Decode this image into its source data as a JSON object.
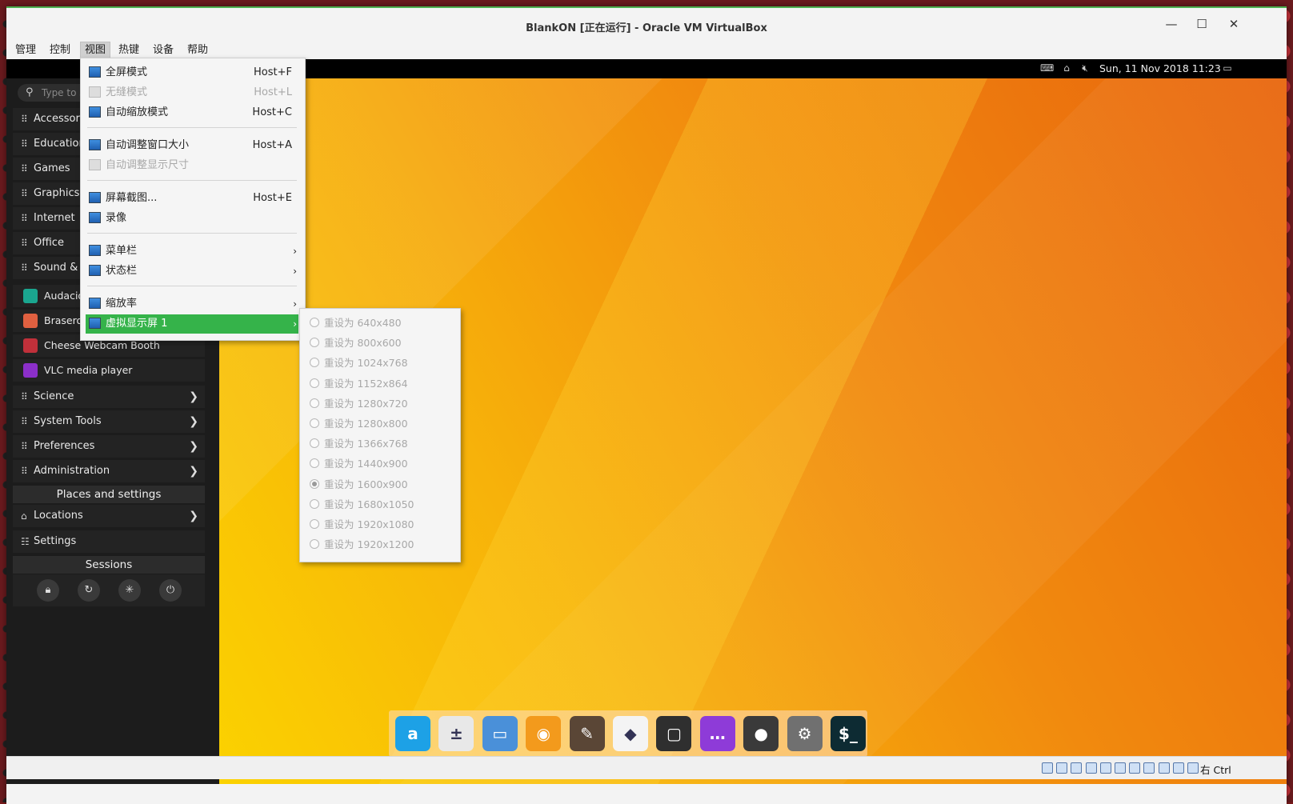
{
  "window": {
    "title": "BlankON [正在运行] - Oracle VM VirtualBox",
    "controls": {
      "minimize": "—",
      "maximize": "☐",
      "close": "✕"
    }
  },
  "menubar": {
    "items": [
      "管理",
      "控制",
      "视图",
      "热键",
      "设备",
      "帮助"
    ],
    "active": "视图"
  },
  "guest_topbar": {
    "clock": "Sun, 11 Nov 2018 11:23",
    "tray_icons": [
      "keyboard-icon",
      "home-icon",
      "volume-muted-icon",
      "window-icon"
    ]
  },
  "app_menu": {
    "search_placeholder": "Type to s",
    "categories_top": [
      "Accessories",
      "Education",
      "Games",
      "Graphics",
      "Internet",
      "Office",
      "Sound & V"
    ],
    "apps": [
      {
        "label": "Audacio",
        "icon": "audacious-icon",
        "color": "#1aa68f"
      },
      {
        "label": "Brasero",
        "icon": "brasero-icon",
        "color": "#e06040"
      },
      {
        "label": "Cheese Webcam Booth",
        "icon": "cheese-icon",
        "color": "#c0303a"
      },
      {
        "label": "VLC media player",
        "icon": "vlc-icon",
        "color": "#8b2fc9"
      }
    ],
    "categories_bottom": [
      "Science",
      "System Tools",
      "Preferences",
      "Administration"
    ],
    "places_header": "Places and settings",
    "locations": "Locations",
    "settings": "Settings",
    "sessions_header": "Sessions",
    "session_buttons": [
      "lock-icon",
      "refresh-icon",
      "suspend-icon",
      "power-icon"
    ]
  },
  "view_menu": {
    "items": [
      {
        "label": "全屏模式",
        "shortcut": "Host+F",
        "disabled": false
      },
      {
        "label": "无缝模式",
        "shortcut": "Host+L",
        "disabled": true
      },
      {
        "label": "自动缩放模式",
        "shortcut": "Host+C",
        "disabled": false
      },
      {
        "label": "自动调整窗口大小",
        "shortcut": "Host+A",
        "disabled": false
      },
      {
        "label": "自动调整显示尺寸",
        "shortcut": "",
        "disabled": true
      },
      {
        "label": "屏幕截图...",
        "shortcut": "Host+E",
        "disabled": false
      },
      {
        "label": "录像",
        "shortcut": "",
        "disabled": false
      },
      {
        "label": "菜单栏",
        "submenu": true
      },
      {
        "label": "状态栏",
        "submenu": true
      },
      {
        "label": "缩放率",
        "submenu": true
      },
      {
        "label": "虚拟显示屏 1",
        "submenu": true,
        "highlighted": true
      }
    ],
    "submenu_chevron": "›"
  },
  "display_submenu": {
    "items": [
      "重设为 640x480",
      "重设为 800x600",
      "重设为 1024x768",
      "重设为 1152x864",
      "重设为 1280x720",
      "重设为 1280x800",
      "重设为 1366x768",
      "重设为 1440x900",
      "重设为 1600x900",
      "重设为 1680x1050",
      "重设为 1920x1080",
      "重设为 1920x1200"
    ],
    "checked": "重设为 1600x900"
  },
  "dock": {
    "apps": [
      {
        "icon": "app-center-icon",
        "glyph": "a",
        "color": "#1da1e6"
      },
      {
        "icon": "calculator-icon",
        "glyph": "±",
        "color": "#e8e8e8"
      },
      {
        "icon": "files-icon",
        "glyph": "▭",
        "color": "#4a90d9"
      },
      {
        "icon": "firefox-icon",
        "glyph": "◉",
        "color": "#f39a1c"
      },
      {
        "icon": "gimp-icon",
        "glyph": "✎",
        "color": "#5a4636"
      },
      {
        "icon": "inkscape-icon",
        "glyph": "◆",
        "color": "#f4f4f4"
      },
      {
        "icon": "libreoffice-icon",
        "glyph": "▢",
        "color": "#2f2f2f"
      },
      {
        "icon": "chat-icon",
        "glyph": "…",
        "color": "#8e3bd8"
      },
      {
        "icon": "screenshot-icon",
        "glyph": "●",
        "color": "#3a3a3a"
      },
      {
        "icon": "system-settings-icon",
        "glyph": "⚙",
        "color": "#707070"
      },
      {
        "icon": "terminal-icon",
        "glyph": "$_",
        "color": "#0d2b33"
      }
    ]
  },
  "statusbar": {
    "host_key": "右 Ctrl",
    "icon_count": 11
  }
}
